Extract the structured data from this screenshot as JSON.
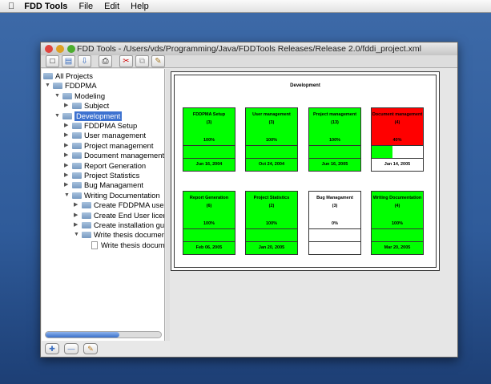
{
  "menubar": {
    "apple": "",
    "app": "FDD Tools",
    "items": [
      "File",
      "Edit",
      "Help"
    ]
  },
  "window": {
    "title": "FDD Tools - /Users/vds/Programming/Java/FDDTools Releases/Release 2.0/fddi_project.xml"
  },
  "toolbar": [
    "new-icon",
    "open-icon",
    "save-icon",
    "print-icon",
    "cut-icon",
    "copy-icon",
    "paste-icon"
  ],
  "tree": [
    {
      "label": "All Projects",
      "level": 0,
      "type": "root",
      "expanded": null
    },
    {
      "label": "FDDPMA",
      "level": 0,
      "type": "folder",
      "expanded": true
    },
    {
      "label": "Modeling",
      "level": 1,
      "type": "folder",
      "expanded": true
    },
    {
      "label": "Subject",
      "level": 2,
      "type": "folder",
      "expanded": false
    },
    {
      "label": "Development",
      "level": 1,
      "type": "folder",
      "expanded": true,
      "selected": true
    },
    {
      "label": "FDDPMA Setup",
      "level": 2,
      "type": "folder",
      "expanded": false
    },
    {
      "label": "User management",
      "level": 2,
      "type": "folder",
      "expanded": false
    },
    {
      "label": "Project management",
      "level": 2,
      "type": "folder",
      "expanded": false
    },
    {
      "label": "Document management",
      "level": 2,
      "type": "folder",
      "expanded": false
    },
    {
      "label": "Report Generation",
      "level": 2,
      "type": "folder",
      "expanded": false
    },
    {
      "label": "Project Statistics",
      "level": 2,
      "type": "folder",
      "expanded": false
    },
    {
      "label": "Bug Managament",
      "level": 2,
      "type": "folder",
      "expanded": false
    },
    {
      "label": "Writing Documentation",
      "level": 2,
      "type": "folder",
      "expanded": true
    },
    {
      "label": "Create FDDPMA user g",
      "level": 3,
      "type": "folder",
      "expanded": false
    },
    {
      "label": "Create End User licenc",
      "level": 3,
      "type": "folder",
      "expanded": false
    },
    {
      "label": "Create installation guid",
      "level": 3,
      "type": "folder",
      "expanded": false
    },
    {
      "label": "Write thesis document",
      "level": 3,
      "type": "folder",
      "expanded": true
    },
    {
      "label": "Write thesis docume",
      "level": 4,
      "type": "doc",
      "expanded": null
    }
  ],
  "diagram": {
    "title": "Development",
    "colors": {
      "complete": "#00ff00",
      "late": "#ff0000",
      "notstarted": "#ffffff"
    },
    "cards": [
      {
        "name": "FDDPMA Setup",
        "count": "(3)",
        "percent": "100%",
        "progress": 100,
        "date": "Jun 16, 2004",
        "status": "complete"
      },
      {
        "name": "User management",
        "count": "(3)",
        "percent": "100%",
        "progress": 100,
        "date": "Oct 24, 2004",
        "status": "complete"
      },
      {
        "name": "Project management",
        "count": "(13)",
        "percent": "100%",
        "progress": 100,
        "date": "Jun 16, 2005",
        "status": "complete"
      },
      {
        "name": "Document management",
        "count": "(4)",
        "percent": "40%",
        "progress": 40,
        "date": "Jan 14, 2005",
        "status": "late"
      },
      {
        "name": "Report Generation",
        "count": "(6)",
        "percent": "100%",
        "progress": 100,
        "date": "Feb 06, 2005",
        "status": "complete"
      },
      {
        "name": "Project Statistics",
        "count": "(2)",
        "percent": "100%",
        "progress": 100,
        "date": "Jan 20, 2005",
        "status": "complete"
      },
      {
        "name": "Bug Managament",
        "count": "(3)",
        "percent": "0%",
        "progress": 0,
        "date": "",
        "status": "notstarted"
      },
      {
        "name": "Writing Documentation",
        "count": "(4)",
        "percent": "100%",
        "progress": 100,
        "date": "Mar 20, 2005",
        "status": "complete"
      }
    ]
  },
  "bottom_buttons": [
    "add-icon",
    "remove-icon",
    "edit-icon"
  ]
}
